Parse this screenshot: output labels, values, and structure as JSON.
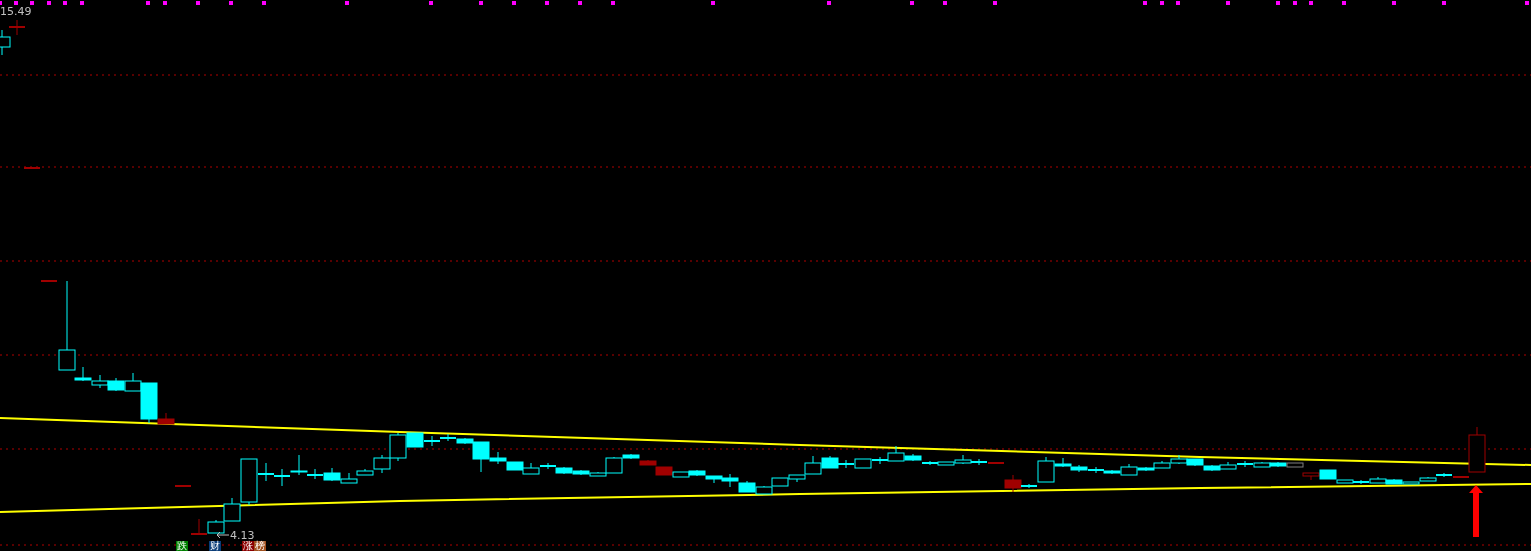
{
  "price_labels": {
    "high": "15.49",
    "low": "4.13"
  },
  "markers": [
    {
      "text": "跌",
      "color": "#008000"
    },
    {
      "text": "财",
      "color": "#0a3c78"
    },
    {
      "text": "涨",
      "color": "#8b0000"
    },
    {
      "text": "榜",
      "color": "#a0501e"
    }
  ]
}
